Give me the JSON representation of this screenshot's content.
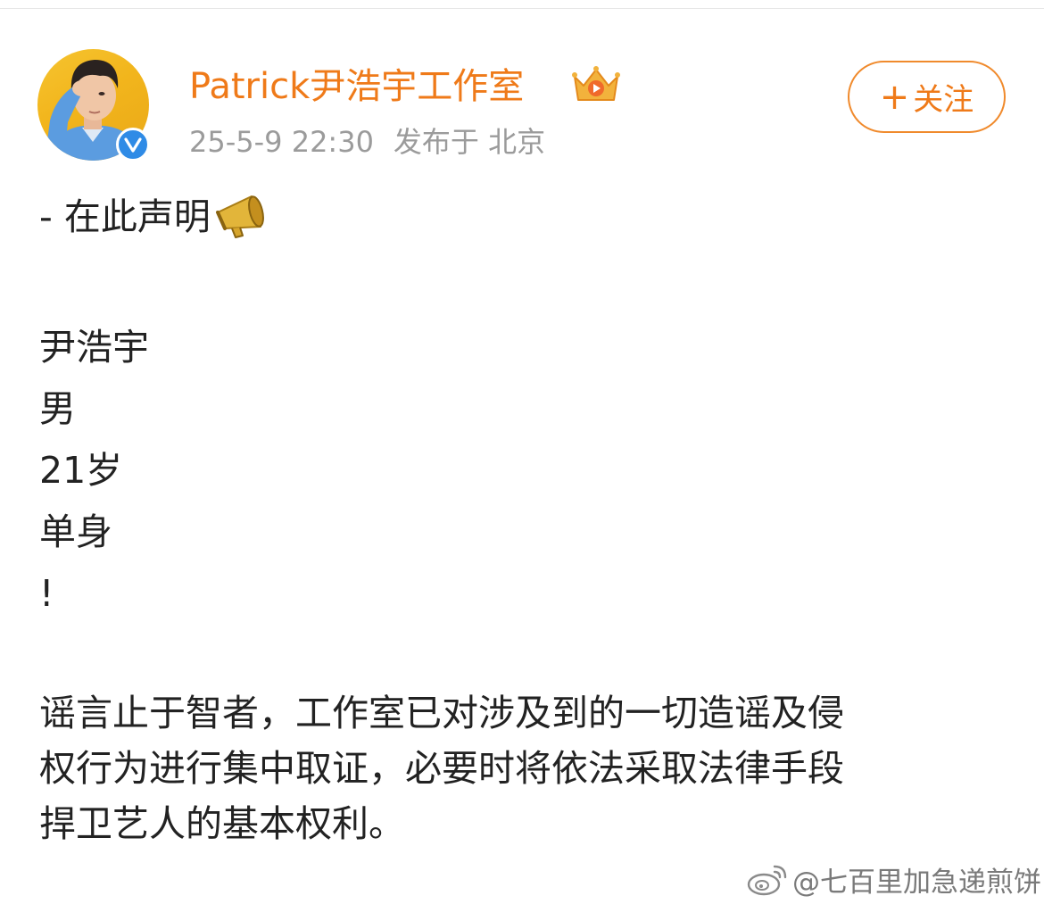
{
  "header": {
    "username": "Patrick尹浩宇工作室",
    "post_time": "25-5-9 22:30",
    "location": "发布于 北京",
    "follow_label": "关注",
    "follow_plus": "+"
  },
  "post": {
    "title": "- 在此声明",
    "short_lines": [
      "尹浩宇",
      "男",
      "21岁",
      "单身",
      "!"
    ],
    "paragraph_lines": [
      "谣言止于智者，工作室已对涉及到的一切造谣及侵",
      "权行为进行集中取证，必要时将依法采取法律手段",
      "捍卫艺人的基本权利。"
    ]
  },
  "watermark": {
    "text": "@七百里加急递煎饼"
  },
  "icons": {
    "avatar": "avatar-photo",
    "verified": "verified-v-icon",
    "crown": "crown-badge-icon",
    "megaphone": "megaphone-icon",
    "weibo": "weibo-logo-icon"
  },
  "colors": {
    "username": "#ef7a19",
    "meta": "#9b9b9b",
    "follow_border": "#f08a2c",
    "verified": "#2f8be6"
  }
}
